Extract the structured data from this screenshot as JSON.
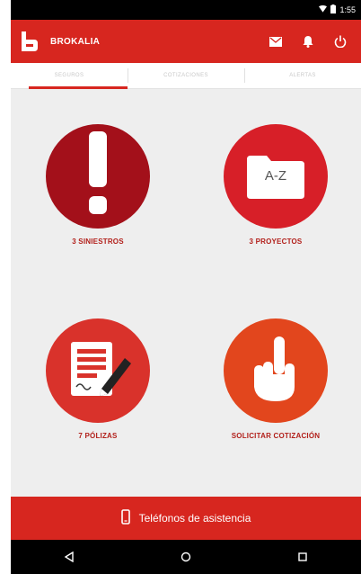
{
  "status_bar": {
    "time": "1:55",
    "wifi_icon": "wifi-icon",
    "battery_icon": "battery-icon"
  },
  "app_bar": {
    "title": "BROKALIA",
    "actions": [
      {
        "icon": "mail-icon"
      },
      {
        "icon": "bell-icon"
      },
      {
        "icon": "power-icon"
      }
    ]
  },
  "tabs": [
    {
      "label": "SEGUROS",
      "active": true
    },
    {
      "label": "COTIZACIONES",
      "active": false
    },
    {
      "label": "ALERTAS",
      "active": false
    }
  ],
  "tiles": [
    {
      "label": "3 SINIESTROS",
      "icon": "exclamation-icon",
      "color": "#a3101a"
    },
    {
      "label": "3 PROYECTOS",
      "icon": "folder-az-icon",
      "color": "#d71f28",
      "folder_text": "A-Z"
    },
    {
      "label": "7 PÓLIZAS",
      "icon": "policy-document-icon",
      "color": "#d9322b"
    },
    {
      "label": "SOLICITAR COTIZACIÓN",
      "icon": "raised-finger-icon",
      "color": "#e2461d"
    }
  ],
  "help_button": {
    "label": "Teléfonos de asistencia",
    "icon": "phone-icon"
  },
  "nav_bar": {
    "buttons": [
      {
        "icon": "back-icon"
      },
      {
        "icon": "home-icon"
      },
      {
        "icon": "recents-icon"
      }
    ]
  },
  "colors": {
    "accent": "#d7261f",
    "label": "#b2201b",
    "background": "#eeeeee"
  }
}
